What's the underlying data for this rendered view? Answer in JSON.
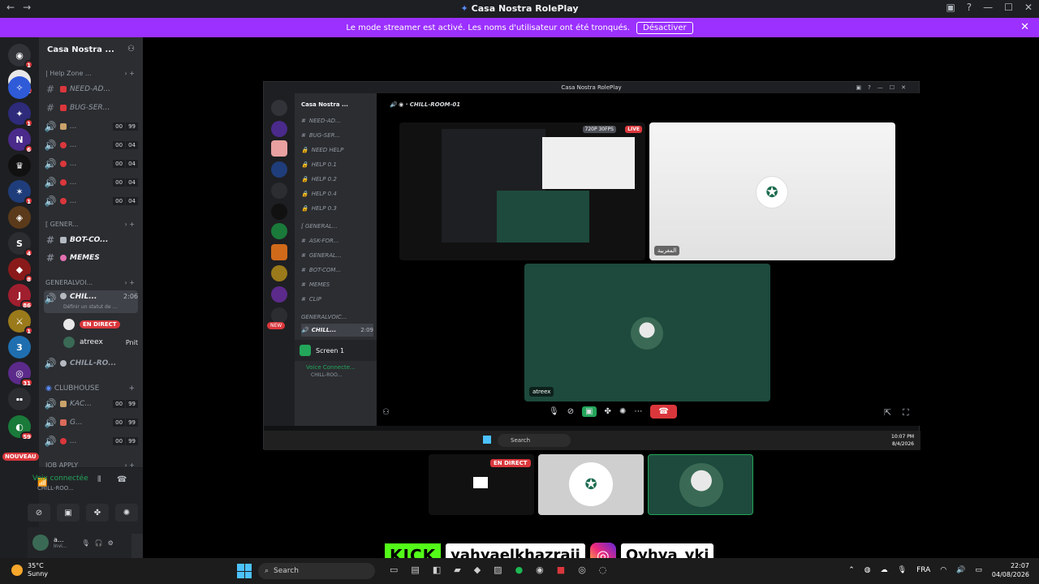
{
  "window": {
    "title": "Casa Nostra RolePlay",
    "back": "←",
    "forward": "→"
  },
  "banner": {
    "text": "Le mode streamer est activé. Les noms d'utilisateur ont été tronqués.",
    "button": "Désactiver",
    "close": "✕"
  },
  "rail": {
    "badges": [
      "1",
      "1",
      "1",
      "6",
      "1",
      "4",
      "8",
      "86",
      "1",
      "31",
      "59"
    ],
    "nouveau": "NOUVEAU"
  },
  "sidebar": {
    "server_name": "Casa Nostra ...",
    "channels": [
      {
        "name": "| Help Zone ...",
        "type": "category"
      },
      {
        "name": "NEED-AD...",
        "type": "text"
      },
      {
        "name": "BUG-SER...",
        "type": "text"
      },
      {
        "name": "...",
        "count_a": "00",
        "count_b": "99",
        "type": "voice"
      },
      {
        "name": "...",
        "count_a": "00",
        "count_b": "04",
        "type": "voice"
      },
      {
        "name": "...",
        "count_a": "00",
        "count_b": "04",
        "type": "voice"
      },
      {
        "name": "...",
        "count_a": "00",
        "count_b": "04",
        "type": "voice"
      },
      {
        "name": "...",
        "count_a": "00",
        "count_b": "04",
        "type": "voice"
      },
      {
        "name": "[ GENER...",
        "type": "category"
      },
      {
        "name": "BOT-CO...",
        "type": "text"
      },
      {
        "name": "MEMES",
        "type": "text"
      },
      {
        "name": "GENERALVOI...",
        "type": "category"
      },
      {
        "name": "CHIL...",
        "time": "2:06",
        "status": "Définir un statut de ...",
        "type": "voice"
      },
      {
        "name": "CHILL-RO...",
        "type": "voice"
      },
      {
        "name": "CLUBHOUSE",
        "type": "category"
      },
      {
        "name": "KAC...",
        "count_a": "00",
        "count_b": "99",
        "type": "voice"
      },
      {
        "name": "G...",
        "count_a": "00",
        "count_b": "99",
        "type": "voice"
      },
      {
        "name": "...",
        "count_a": "00",
        "count_b": "99",
        "type": "voice"
      },
      {
        "name": "JOB APPLY",
        "type": "category"
      }
    ],
    "live_badge": "EN DIRECT",
    "user2": "atreex",
    "user2_status": "Pnit",
    "voice_connected": "Voix connectée",
    "voice_channel": "CHILL-ROO...",
    "user_name": "a...",
    "user_sub": "Invi..."
  },
  "inner": {
    "title": "Casa Nostra RolePlay",
    "server_name": "Casa Nostra ...",
    "voice_channel_title": "CHILL-ROOM-01",
    "channels": [
      "NEED-AD...",
      "BUG-SER...",
      "NEED HELP",
      "HELP 0.1",
      "HELP 0.2",
      "HELP 0.4",
      "HELP 0.3",
      "[ GENERAL...",
      "ASK-FOR...",
      "GENERAL...",
      "BOT-COM...",
      "MEMES",
      "CLIP",
      "GENERALVOIC..."
    ],
    "active_channel": "CHILL...",
    "active_time": "2:09",
    "screen": "Screen 1",
    "voice_connected": "Voice Connecte...",
    "voice_channel": "CHILL-ROO...",
    "new_badge": "NEW",
    "quality": "720P 30FPS",
    "live": "LIVE",
    "tile_label_1": "المغربية",
    "tile_label_2": "atreex",
    "search": "Search",
    "clock_time": "10:07 PM",
    "clock_date": "8/4/2026"
  },
  "preview": {
    "live": "EN DIRECT"
  },
  "social": {
    "kick": "KICK",
    "kick_handle": "yahyaelkhazraji",
    "ig_handle": "Oyhya_ykj"
  },
  "taskbar": {
    "temp": "35°C",
    "weather": "Sunny",
    "search": "Search",
    "lang": "FRA",
    "time": "22:07",
    "date": "04/08/2026"
  },
  "colors": {
    "accent": "#9b30ff",
    "live": "#da373c",
    "kick": "#53fc18",
    "tile_green": "#1d4a3c"
  }
}
